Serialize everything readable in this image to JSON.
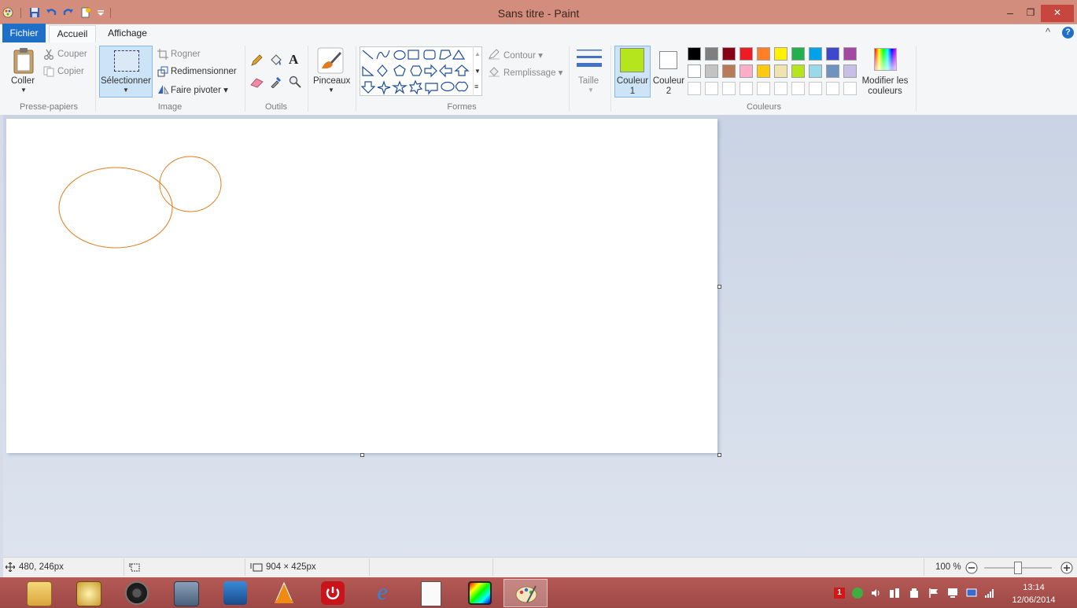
{
  "window": {
    "title": "Sans titre - Paint",
    "minimize_glyph": "–",
    "restore_glyph": "❐",
    "close_glyph": "✕"
  },
  "tabs": {
    "file": "Fichier",
    "home": "Accueil",
    "view": "Affichage",
    "collapse_glyph": "^",
    "help_glyph": "?"
  },
  "clipboard": {
    "paste": "Coller",
    "cut": "Couper",
    "copy": "Copier",
    "group": "Presse-papiers"
  },
  "image": {
    "select": "Sélectionner",
    "crop": "Rogner",
    "resize": "Redimensionner",
    "rotate": "Faire pivoter ▾",
    "group": "Image"
  },
  "tools": {
    "text_glyph": "A",
    "group": "Outils"
  },
  "brushes": {
    "label": "Pinceaux"
  },
  "shapes": {
    "outline": "Contour ▾",
    "fill": "Remplissage ▾",
    "group": "Formes"
  },
  "size": {
    "label": "Taille"
  },
  "colors": {
    "color1_label": "Couleur 1",
    "color2_label": "Couleur 2",
    "color1_value": "#b5e61d",
    "color2_value": "#ffffff",
    "edit_label": "Modifier les couleurs",
    "group": "Couleurs",
    "palette_row1": [
      "#000000",
      "#7f7f7f",
      "#880015",
      "#ed1c24",
      "#ff7f27",
      "#fff200",
      "#22b14c",
      "#00a2e8",
      "#3f48cc",
      "#a349a4"
    ],
    "palette_row2": [
      "#ffffff",
      "#c3c3c3",
      "#b97a57",
      "#ffaec9",
      "#ffc90e",
      "#efe4b0",
      "#b5e61d",
      "#99d9ea",
      "#7092be",
      "#c8bfe7"
    ]
  },
  "drawing": {
    "stroke_color": "#e07c1e"
  },
  "status": {
    "cursor_pos": "480, 246px",
    "image_size": "904 × 425px",
    "zoom": "100 %",
    "zoom_level_fraction": 0.5
  },
  "taskbar": {
    "time": "13:14",
    "date": "12/06/2014"
  }
}
